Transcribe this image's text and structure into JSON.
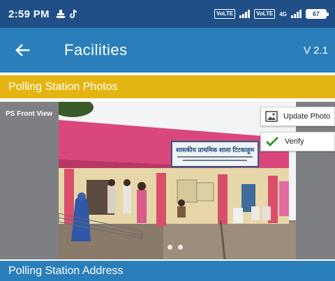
{
  "status_bar": {
    "time": "2:59 PM",
    "left_icons": [
      "ship-icon",
      "tiktok-icon"
    ],
    "badges": [
      "VoLTE",
      "VoLTE"
    ],
    "network_label": "4G",
    "battery": "67"
  },
  "app_bar": {
    "title": "Facilities",
    "version": "V 2.1"
  },
  "sections": {
    "photos_header": "Polling Station Photos",
    "address_header": "Polling Station Address"
  },
  "photo": {
    "caption": "PS Front View",
    "signboard_text": "शासकीय प्राथमिक शाला टिटकाहूम",
    "carousel_count": 2
  },
  "actions": {
    "update_photo": "Update Photo",
    "verify": "Verify"
  },
  "colors": {
    "status_bar": "#1f4f86",
    "app_bar": "#2a7fba",
    "photos_header": "#e4b512",
    "verify_check": "#2e9a2e"
  }
}
